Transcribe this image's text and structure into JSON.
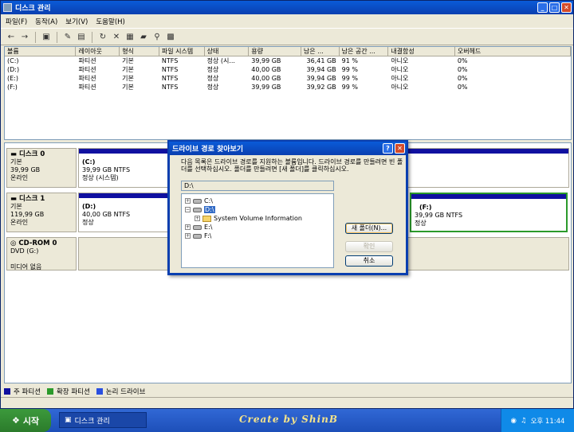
{
  "window": {
    "title": "디스크 관리"
  },
  "menu": [
    "파일(F)",
    "동작(A)",
    "보기(V)",
    "도움말(H)"
  ],
  "volume_table": {
    "headers": [
      "볼륨",
      "레이아웃",
      "형식",
      "파일 시스템",
      "상태",
      "용량",
      "남은 ...",
      "남은 공간 ...",
      "내결함성",
      "오버헤드"
    ],
    "rows": [
      [
        "(C:)",
        "파티션",
        "기본",
        "NTFS",
        "정상 (시...",
        "39,99 GB",
        "36,41 GB",
        "91 %",
        "아니오",
        "0%"
      ],
      [
        "(D:)",
        "파티션",
        "기본",
        "NTFS",
        "정상",
        "40,00 GB",
        "39,94 GB",
        "99 %",
        "아니오",
        "0%"
      ],
      [
        "(E:)",
        "파티션",
        "기본",
        "NTFS",
        "정상",
        "40,00 GB",
        "39,94 GB",
        "99 %",
        "아니오",
        "0%"
      ],
      [
        "(F:)",
        "파티션",
        "기본",
        "NTFS",
        "정상",
        "39,99 GB",
        "39,92 GB",
        "99 %",
        "아니오",
        "0%"
      ]
    ]
  },
  "disks": [
    {
      "name": "디스크 0",
      "type": "기본",
      "size": "39,99 GB",
      "status": "온라인",
      "partitions": [
        {
          "label": "(C:)",
          "fs": "39,99 GB NTFS",
          "state": "정상 (시스템)"
        }
      ]
    },
    {
      "name": "디스크 1",
      "type": "기본",
      "size": "119,99 GB",
      "status": "온라인",
      "partitions": [
        {
          "label": "(D:)",
          "fs": "40,00 GB NTFS",
          "state": "정상"
        },
        {
          "label": "(F:)",
          "fs": "39,99 GB NTFS",
          "state": "정상"
        }
      ]
    },
    {
      "name": "CD-ROM 0",
      "type": "DVD (G:)",
      "size": "",
      "status": "미디어 없음",
      "partitions": []
    }
  ],
  "legend": [
    {
      "label": "주 파티션",
      "color": "#1010a0"
    },
    {
      "label": "확장 파티션",
      "color": "#2b9a2b"
    },
    {
      "label": "논리 드라이브",
      "color": "#2a4fe0"
    }
  ],
  "dialog": {
    "title": "드라이브 경로 찾아보기",
    "message": "다음 목록은 드라이브 경로를 지원하는 볼륨입니다. 드라이브 경로를 만들려면 빈 폴더를 선택하십시오. 폴더를 만들려면 [새 폴더]를 클릭하십시오.",
    "path": "D:\\",
    "tree": [
      "C:\\",
      "D:\\",
      "System Volume Information",
      "E:\\",
      "F:\\"
    ],
    "new_folder": "새 폴더(N)...",
    "ok": "확인",
    "cancel": "취소"
  },
  "taskbar": {
    "start": "시작",
    "task": "디스크 관리",
    "brand": "Create by ShinB",
    "time": "오후 11:44"
  }
}
